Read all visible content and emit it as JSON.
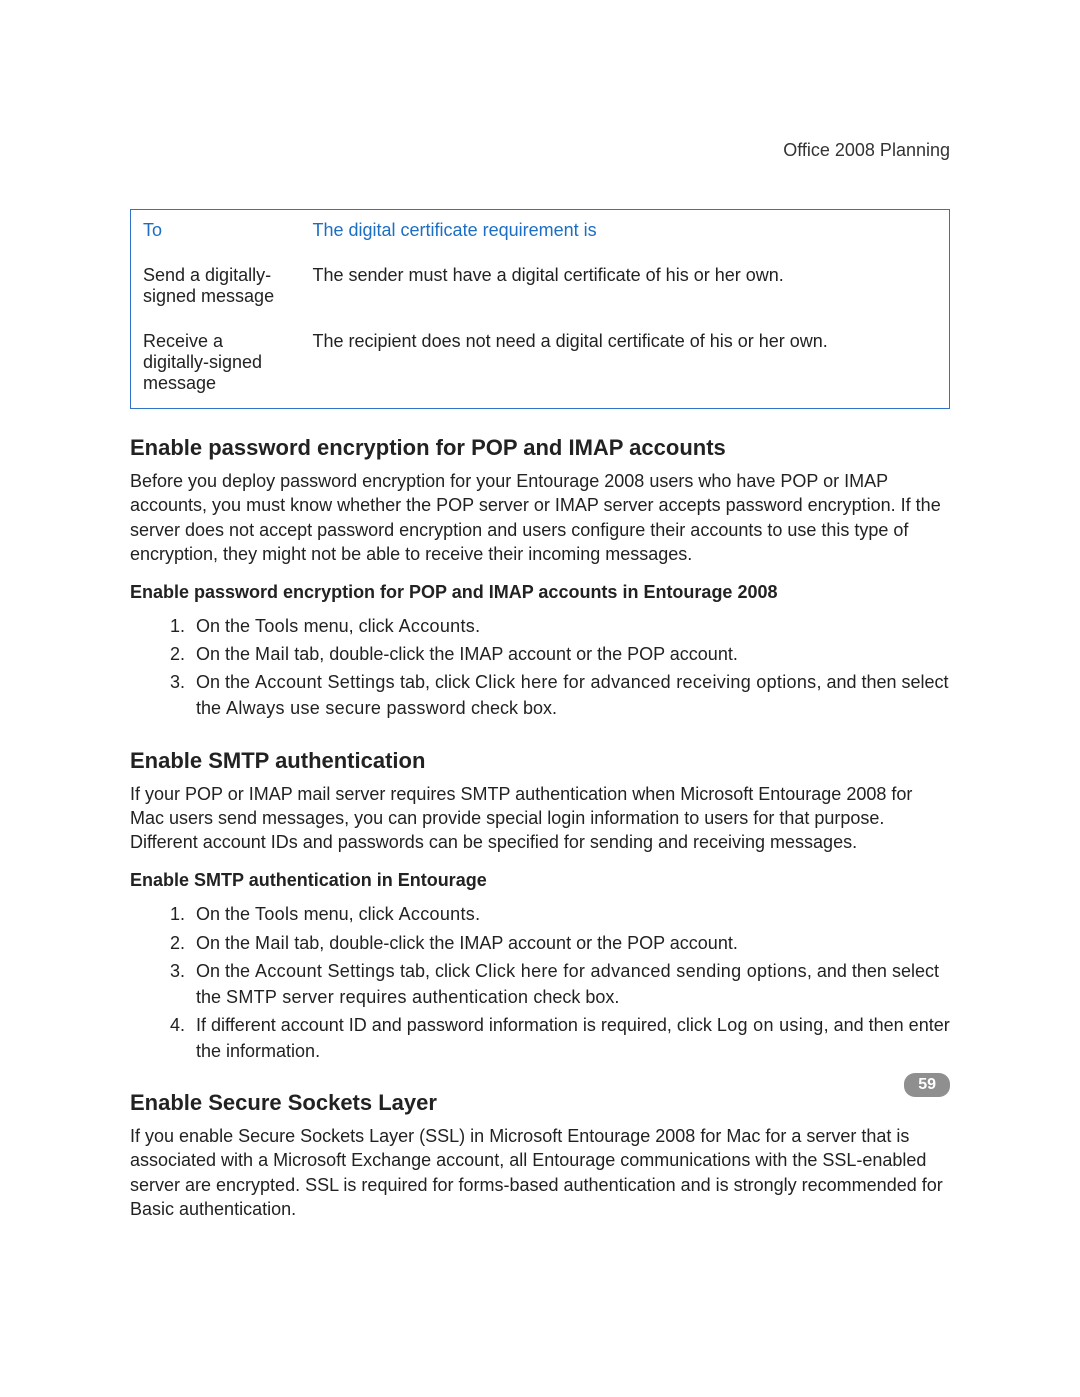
{
  "running_head": "Office 2008 Planning",
  "table": {
    "header_to": "To",
    "header_req": "The digital certificate requirement is",
    "row1_to": "Send a digitally-signed message",
    "row1_req": "The sender must have a digital certificate of his or her own.",
    "row2_to": "Receive a digitally-signed message",
    "row2_req": "The recipient does not need a digital certificate of his or her own."
  },
  "sec1": {
    "heading": "Enable password encryption for POP and IMAP accounts",
    "para": "Before you deploy password encryption for your Entourage 2008 users who have POP or IMAP accounts, you must know whether the POP server or IMAP server accepts password encryption. If the server does not accept password encryption and users configure their accounts to use this type of encryption, they might not be able to receive their incoming messages.",
    "subhead": "Enable password encryption for POP and IMAP accounts in Entourage 2008",
    "step1_a": "On the ",
    "step1_b": "Tools",
    "step1_c": " menu, click ",
    "step1_d": "Accounts",
    "step1_e": ".",
    "step2_a": "On the ",
    "step2_b": "Mail",
    "step2_c": " tab, double-click the IMAP account or the POP account.",
    "step3_a": "On the ",
    "step3_b": "Account Settings",
    "step3_c": " tab, click ",
    "step3_d": "Click here for advanced receiving options",
    "step3_e": ", and then select the ",
    "step3_f": "Always use secure password",
    "step3_g": " check box."
  },
  "sec2": {
    "heading": "Enable SMTP authentication",
    "para": "If your POP or IMAP mail server requires SMTP authentication when Microsoft Entourage 2008 for Mac users send messages, you can provide special login information to users for that purpose. Different account IDs and passwords can be specified for sending and receiving messages.",
    "subhead": "Enable SMTP authentication in Entourage",
    "step1_a": "On the ",
    "step1_b": "Tools",
    "step1_c": " menu, click ",
    "step1_d": "Accounts",
    "step1_e": ".",
    "step2_a": "On the ",
    "step2_b": "Mail",
    "step2_c": " tab, double-click the IMAP account or the POP account.",
    "step3_a": "On the ",
    "step3_b": "Account Settings",
    "step3_c": " tab, click ",
    "step3_d": "Click here for advanced sending options",
    "step3_e": ", and then select the ",
    "step3_f": "SMTP server requires authentication",
    "step3_g": " check box.",
    "step4_a": "If different account ID and password information is required, click ",
    "step4_b": "Log on using",
    "step4_c": ", and then enter the information."
  },
  "sec3": {
    "heading": "Enable Secure Sockets Layer",
    "para": "If you enable Secure Sockets Layer (SSL) in Microsoft Entourage 2008 for Mac for a server that is associated with a Microsoft Exchange account, all Entourage communications with the SSL-enabled server are encrypted. SSL is required for forms-based authentication and is strongly recommended for Basic authentication."
  },
  "page_number": "59"
}
